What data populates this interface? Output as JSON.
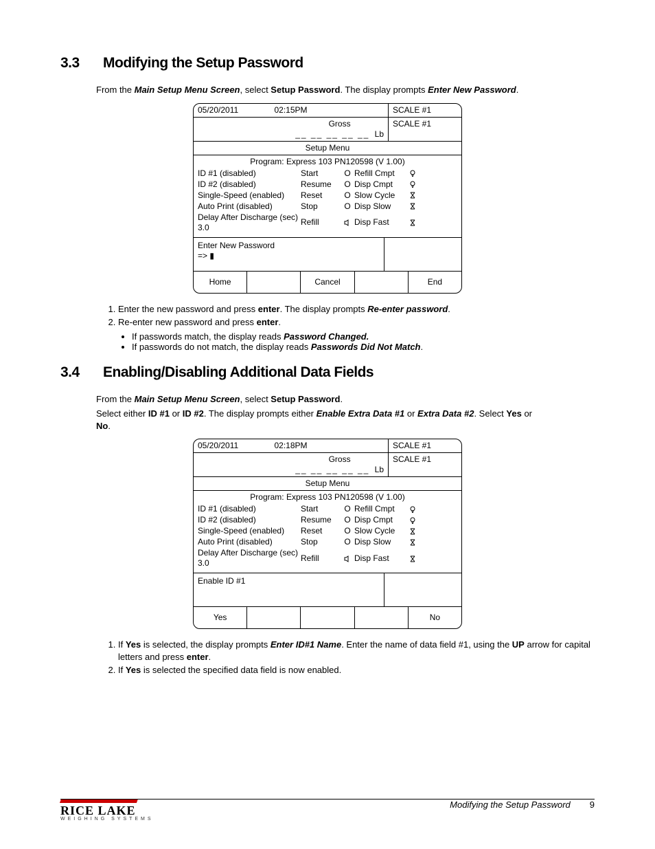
{
  "section33": {
    "num": "3.3",
    "title": "Modifying the Setup Password",
    "intro_pre": "From the ",
    "intro_mainmenu": "Main Setup Menu Screen",
    "intro_mid": ", select ",
    "intro_setuppw": "Setup Password",
    "intro_post": ". The display prompts",
    "intro_enterpw": "Enter New Password",
    "intro_end": ".",
    "screen": {
      "date": "05/20/2011",
      "time": "02:15PM",
      "scale_a": "SCALE #1",
      "gross": "Gross",
      "dashes": "__ __ __ __ __",
      "lb": "Lb",
      "scale_b": "SCALE #1",
      "setup_menu": "Setup Menu",
      "program": "Program: Express 103 PN120598  (V 1.00)",
      "col1": [
        "ID #1 (disabled)",
        "ID #2 (disabled)",
        "Single-Speed (enabled)",
        "Auto Print (disabled)",
        "Delay After Discharge (sec) 3.0"
      ],
      "col2": [
        "Start",
        "Resume",
        "Reset",
        "Stop",
        "Refill"
      ],
      "col3": [
        "O",
        "O",
        "O",
        "O",
        ""
      ],
      "col4": [
        "Refill Cmpt",
        "Disp Cmpt",
        "Slow Cycle",
        "Disp Slow",
        "Disp Fast"
      ],
      "prompt1": "Enter New Password",
      "prompt2": "=> ▮",
      "btn1": "Home",
      "btn2": "",
      "btn3": "Cancel",
      "btn4": "",
      "btn5": "End"
    },
    "step1_a": "Enter the new password and press ",
    "step1_enter": "enter",
    "step1_b": ". The display prompts ",
    "step1_reenter": "Re-enter password",
    "step1_c": ".",
    "step2_a": "Re-enter new password and press ",
    "step2_enter": "enter",
    "step2_b": ".",
    "bullet1_a": "If passwords match, the display reads ",
    "bullet1_i": "Password Changed.",
    "bullet2_a": "If passwords do not match, the display reads ",
    "bullet2_i": "Passwords Did Not Match",
    "bullet2_b": "."
  },
  "section34": {
    "num": "3.4",
    "title": "Enabling/Disabling Additional Data Fields",
    "intro_a": "From the ",
    "intro_mainmenu": "Main Setup Menu Screen",
    "intro_b": ", select ",
    "intro_setuppw": "Setup Password",
    "intro_c": ".",
    "p2_a": "Select either ",
    "p2_id1": "ID #1",
    "p2_b": " or ",
    "p2_id2": "ID #2",
    "p2_c": ". The display prompts either ",
    "p2_e1": "Enable Extra Data #1",
    "p2_d": " or ",
    "p2_e2": "Extra Data #2",
    "p2_e": ". Select ",
    "p2_yes": "Yes",
    "p2_f": " or ",
    "p2_no": "No",
    "p2_g": ".",
    "screen": {
      "date": "05/20/2011",
      "time": "02:18PM",
      "scale_a": "SCALE #1",
      "gross": "Gross",
      "dashes": "__ __ __ __ __",
      "lb": "Lb",
      "scale_b": "SCALE #1",
      "setup_menu": "Setup Menu",
      "program": "Program: Express 103 PN120598  (V 1.00)",
      "col1": [
        "ID #1 (disabled)",
        "ID #2 (disabled)",
        "Single-Speed (enabled)",
        "Auto Print (disabled)",
        "Delay After Discharge (sec) 3.0"
      ],
      "col2": [
        "Start",
        "Resume",
        "Reset",
        "Stop",
        "Refill"
      ],
      "col3": [
        "O",
        "O",
        "O",
        "O",
        ""
      ],
      "col4": [
        "Refill Cmpt",
        "Disp Cmpt",
        "Slow Cycle",
        "Disp Slow",
        "Disp Fast"
      ],
      "prompt1": "Enable ID #1",
      "btn1": "Yes",
      "btn2": "",
      "btn3": "",
      "btn4": "",
      "btn5": "No"
    },
    "step1_a": "If ",
    "step1_yes": "Yes",
    "step1_b": " is selected, the display prompts ",
    "step1_enterid": "Enter ID#1 Name",
    "step1_c": ". Enter the name of data field #1, using the ",
    "step1_up": "UP",
    "step1_d": " arrow for capital letters and press ",
    "step1_enter": "enter",
    "step1_e": ".",
    "step2_a": "If ",
    "step2_yes": "Yes",
    "step2_b": " is selected the specified data field is now enabled."
  },
  "footer": {
    "logo_name": "RICE LAKE",
    "logo_sub": "WEIGHING SYSTEMS",
    "title": "Modifying the Setup Password",
    "page": "9"
  }
}
